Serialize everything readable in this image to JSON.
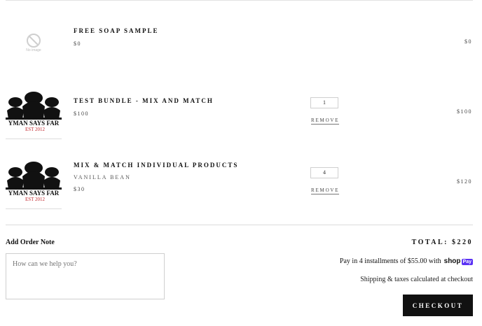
{
  "items": [
    {
      "title": "FREE SOAP SAMPLE",
      "variant": "",
      "price": "$0",
      "quantity": "",
      "remove_label": "",
      "line_total": "$0",
      "thumbnail": "no-image-placeholder",
      "thumbnail_text": "No image"
    },
    {
      "title": "TEST BUNDLE - MIX AND MATCH",
      "variant": "",
      "price": "$100",
      "quantity": "1",
      "remove_label": "REMOVE",
      "line_total": "$100",
      "thumbnail": "farm-logo",
      "thumbnail_text": "YMAN SAYS FAR",
      "thumbnail_est": "EST 2012"
    },
    {
      "title": "MIX & MATCH INDIVIDUAL PRODUCTS",
      "variant": "VANILLA BEAN",
      "price": "$30",
      "quantity": "4",
      "remove_label": "REMOVE",
      "line_total": "$120",
      "thumbnail": "farm-logo",
      "thumbnail_text": "YMAN SAYS FAR",
      "thumbnail_est": "EST 2012"
    }
  ],
  "order_note": {
    "label": "Add Order Note",
    "placeholder": "How can we help you?"
  },
  "summary": {
    "total": "TOTAL: $220",
    "installments_text": "Pay in 4 installments of $55.00 with",
    "shop_pay_brand": "shop",
    "shop_pay_badge": "Pay",
    "shipping_note": "Shipping & taxes calculated at checkout",
    "checkout_label": "CHECKOUT"
  },
  "colors": {
    "checkout_bg": "#111111",
    "shop_pay_purple": "#5a31f4",
    "logo_red": "#c1272d"
  }
}
